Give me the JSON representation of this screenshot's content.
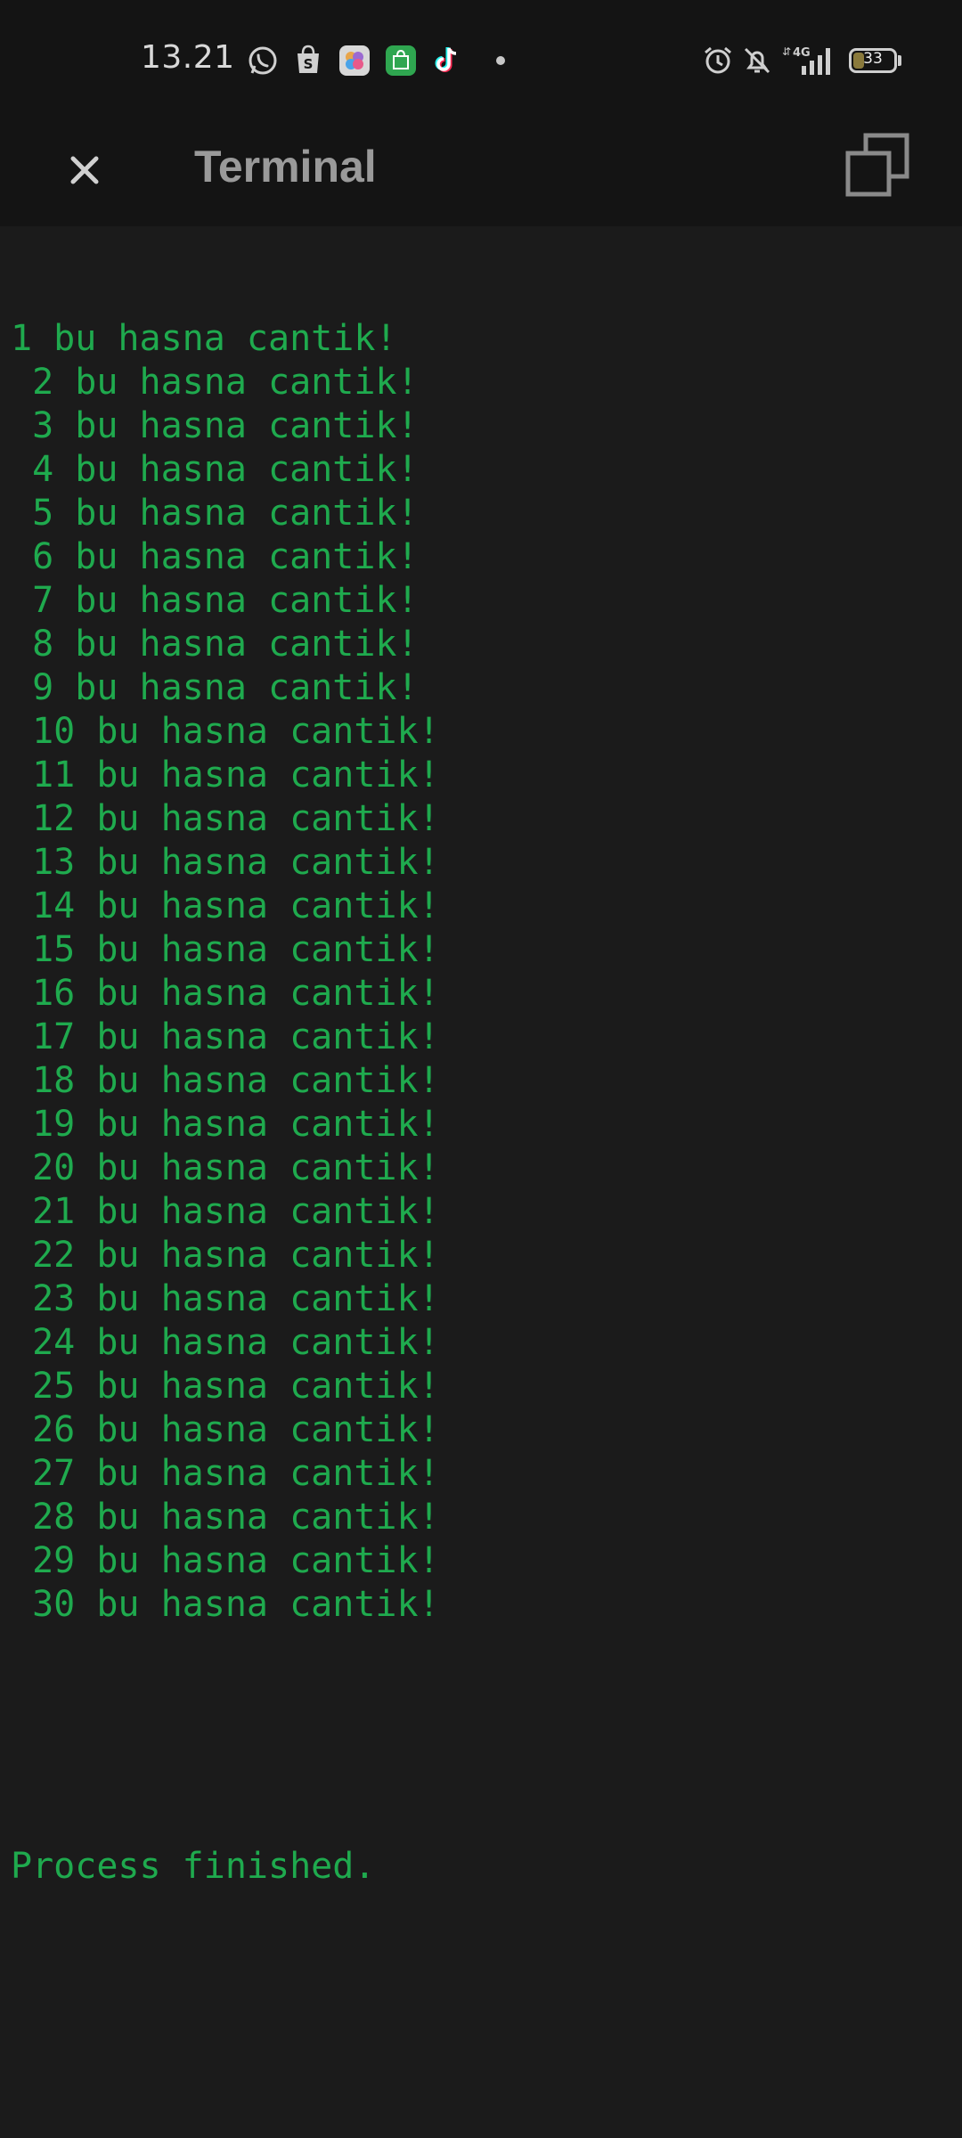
{
  "status_bar": {
    "time": "13.21",
    "network": "4G",
    "battery_level": "33",
    "battery_percent": 33,
    "notification_icons": [
      "whatsapp-icon",
      "shopee-icon",
      "photos-icon",
      "shopping-bag-icon",
      "tiktok-icon",
      "dot-icon"
    ],
    "system_icons": [
      "alarm-icon",
      "bell-muted-icon",
      "signal-4g-icon",
      "battery-icon"
    ]
  },
  "app_bar": {
    "title": "Terminal",
    "close_icon": "close-icon",
    "copy_icon": "copy-icon"
  },
  "terminal": {
    "text_color": "#1faa4e",
    "lines": [
      "1 bu hasna cantik!",
      " 2 bu hasna cantik!",
      " 3 bu hasna cantik!",
      " 4 bu hasna cantik!",
      " 5 bu hasna cantik!",
      " 6 bu hasna cantik!",
      " 7 bu hasna cantik!",
      " 8 bu hasna cantik!",
      " 9 bu hasna cantik!",
      " 10 bu hasna cantik!",
      " 11 bu hasna cantik!",
      " 12 bu hasna cantik!",
      " 13 bu hasna cantik!",
      " 14 bu hasna cantik!",
      " 15 bu hasna cantik!",
      " 16 bu hasna cantik!",
      " 17 bu hasna cantik!",
      " 18 bu hasna cantik!",
      " 19 bu hasna cantik!",
      " 20 bu hasna cantik!",
      " 21 bu hasna cantik!",
      " 22 bu hasna cantik!",
      " 23 bu hasna cantik!",
      " 24 bu hasna cantik!",
      " 25 bu hasna cantik!",
      " 26 bu hasna cantik!",
      " 27 bu hasna cantik!",
      " 28 bu hasna cantik!",
      " 29 bu hasna cantik!",
      " 30 bu hasna cantik!"
    ],
    "process_status": "Process finished."
  }
}
